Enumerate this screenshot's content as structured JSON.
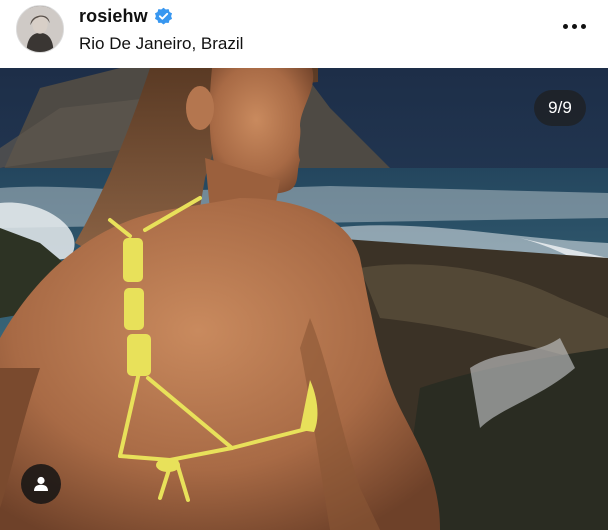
{
  "post": {
    "username": "rosiehw",
    "location": "Rio De Janeiro, Brazil",
    "verified": true,
    "carousel": {
      "current": 9,
      "total": 9,
      "label": "9/9"
    }
  },
  "icons": {
    "avatar": "profile-photo",
    "verified": "verified-badge-icon",
    "more": "more-options-icon",
    "tags": "user-tag-icon"
  },
  "colors": {
    "verified_blue": "#3897f0",
    "badge_background": "#1e1e1e",
    "bikini_yellow": "#e8e15a"
  }
}
